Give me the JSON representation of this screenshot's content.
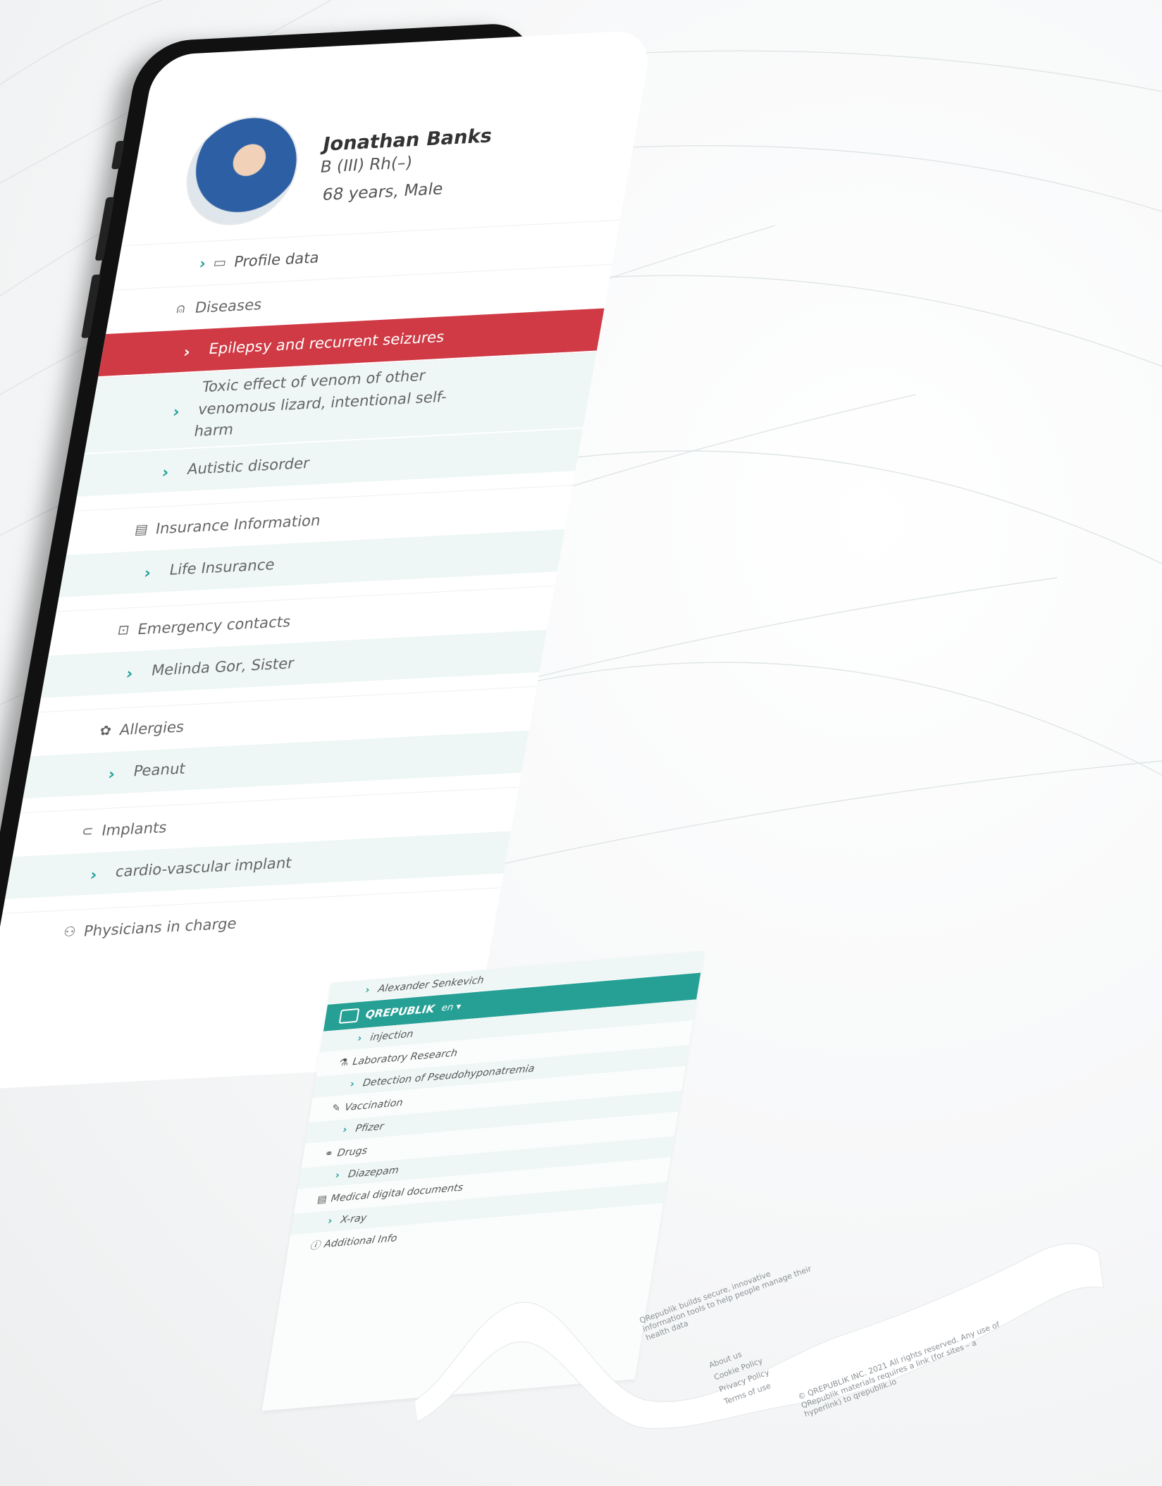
{
  "profile": {
    "name": "Jonathan Banks",
    "blood_type": "B (III) Rh(–)",
    "age_gender": "68 years, Male"
  },
  "profile_data_label": "Profile data",
  "sections": [
    {
      "id": "diseases",
      "icon": "siren-icon",
      "title": "Diseases",
      "items": [
        "Epilepsy and recurrent seizures",
        "Toxic effect of venom of other venomous lizard, intentional self-harm",
        "Autistic disorder"
      ],
      "highlighted_index": 0
    },
    {
      "id": "insurance",
      "icon": "document-icon",
      "title": "Insurance Information",
      "items": [
        "Life Insurance"
      ]
    },
    {
      "id": "emergency",
      "icon": "contact-card-icon",
      "title": "Emergency contacts",
      "items": [
        "Melinda Gor, Sister"
      ]
    },
    {
      "id": "allergies",
      "icon": "allergy-icon",
      "title": "Allergies",
      "items": [
        "Peanut"
      ]
    },
    {
      "id": "implants",
      "icon": "implant-icon",
      "title": "Implants",
      "items": [
        "cardio-vascular implant"
      ]
    },
    {
      "id": "physicians",
      "icon": "people-icon",
      "title": "Physicians in charge",
      "items": [
        "Alexander Senkevich"
      ]
    }
  ],
  "app_bar": {
    "brand": "QREPUBLIK",
    "language": "en"
  },
  "ribbon_sections": [
    {
      "title": "",
      "items": [
        "injection"
      ]
    },
    {
      "title": "Laboratory Research",
      "icon": "flask-icon",
      "items": [
        "Detection of Pseudohyponatremia"
      ]
    },
    {
      "title": "Vaccination",
      "icon": "syringe-icon",
      "items": [
        "Pfizer"
      ]
    },
    {
      "title": "Drugs",
      "icon": "pill-icon",
      "items": [
        "Diazepam"
      ]
    },
    {
      "title": "Medical digital documents",
      "icon": "file-icon",
      "items": [
        "X-ray"
      ]
    },
    {
      "title": "Additional Info",
      "icon": "info-icon",
      "items": []
    }
  ],
  "footer": {
    "tagline": "QRepublik builds secure, innovative information tools to help people manage their health data",
    "links": [
      "About us",
      "Cookie Policy",
      "Privacy Policy",
      "Terms of use"
    ],
    "copyright": "© QREPUBLIK INC. 2021 All rights reserved. Any use of QRepublik materials requires a link (for sites – a hyperlink) to qrepublik.io",
    "brand_url": "qrepublik.io"
  },
  "colors": {
    "accent": "#1fa097",
    "highlight": "#cf3a45",
    "app_bar": "#26a095"
  }
}
